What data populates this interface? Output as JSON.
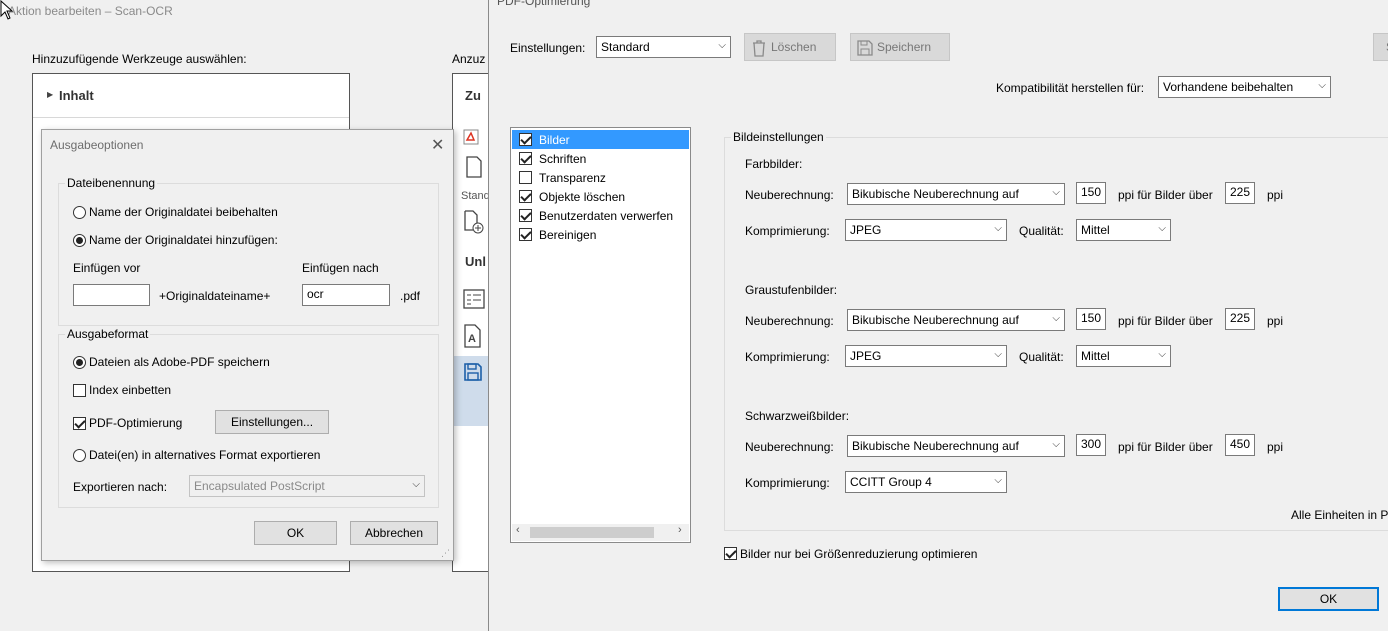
{
  "bg_window": {
    "title": "Aktion bearbeiten – Scan-OCR",
    "left_label": "Hinzuzufügende Werkzeuge auswählen:",
    "right_label": "Anzuz",
    "tool_panel_item": "Inhalt",
    "right_panel": {
      "zu": "Zu",
      "stand": "Stand",
      "unl": "Unl"
    }
  },
  "ausgabe": {
    "title": "Ausgabeoptionen",
    "dateibenennung": {
      "title": "Dateibenennung",
      "radio_keep": "Name der Originaldatei beibehalten",
      "radio_add": "Name der Originaldatei hinzufügen:",
      "einfuegen_vor_label": "Einfügen vor",
      "einfuegen_vor_value": "",
      "einfuegen_nach_label": "Einfügen nach",
      "einfuegen_nach_value": "ocr",
      "middle_text": "+Originaldateiname+",
      "ext": ".pdf"
    },
    "ausgabeformat": {
      "title": "Ausgabeformat",
      "radio_pdf": "Dateien als Adobe-PDF speichern",
      "index_label": "Index einbetten",
      "pdfopt_label": "PDF-Optimierung",
      "settings_button": "Einstellungen...",
      "radio_alt": "Datei(en) in alternatives Format exportieren",
      "export_label": "Exportieren nach:",
      "export_value": "Encapsulated PostScript"
    },
    "ok": "OK",
    "cancel": "Abbrechen"
  },
  "pdf": {
    "title": "PDF-Optimierung",
    "settings_label": "Einstellungen:",
    "settings_value": "Standard",
    "delete_button": "Löschen",
    "save_button": "Speichern",
    "edge_button": "S",
    "compat_label": "Kompatibilität herstellen für:",
    "compat_value": "Vorhandene beibehalten",
    "categories": [
      {
        "label": "Bilder",
        "checked": true,
        "selected": true
      },
      {
        "label": "Schriften",
        "checked": true,
        "selected": false
      },
      {
        "label": "Transparenz",
        "checked": false,
        "selected": false
      },
      {
        "label": "Objekte löschen",
        "checked": true,
        "selected": false
      },
      {
        "label": "Benutzerdaten verwerfen",
        "checked": true,
        "selected": false
      },
      {
        "label": "Bereinigen",
        "checked": true,
        "selected": false
      }
    ],
    "bildeinstellungen": "Bildeinstellungen",
    "sections": [
      {
        "title": "Farbbilder:",
        "resample_label": "Neuberechnung:",
        "resample_value": "Bikubische Neuberechnung auf",
        "ppi": "150",
        "above_label": "ppi für Bilder über",
        "above_ppi": "225",
        "ppi_unit": "ppi",
        "compress_label": "Komprimierung:",
        "compress_value": "JPEG",
        "quality_label": "Qualität:",
        "quality_value": "Mittel"
      },
      {
        "title": "Graustufenbilder:",
        "resample_label": "Neuberechnung:",
        "resample_value": "Bikubische Neuberechnung auf",
        "ppi": "150",
        "above_label": "ppi für Bilder über",
        "above_ppi": "225",
        "ppi_unit": "ppi",
        "compress_label": "Komprimierung:",
        "compress_value": "JPEG",
        "quality_label": "Qualität:",
        "quality_value": "Mittel"
      },
      {
        "title": "Schwarzweißbilder:",
        "resample_label": "Neuberechnung:",
        "resample_value": "Bikubische Neuberechnung auf",
        "ppi": "300",
        "above_label": "ppi für Bilder über",
        "above_ppi": "450",
        "ppi_unit": "ppi",
        "compress_label": "Komprimierung:",
        "compress_value": "CCITT Group 4"
      }
    ],
    "units_note": "Alle Einheiten in Pi",
    "only_reduce_label": "Bilder nur bei Größenreduzierung optimieren",
    "ok": "OK"
  }
}
